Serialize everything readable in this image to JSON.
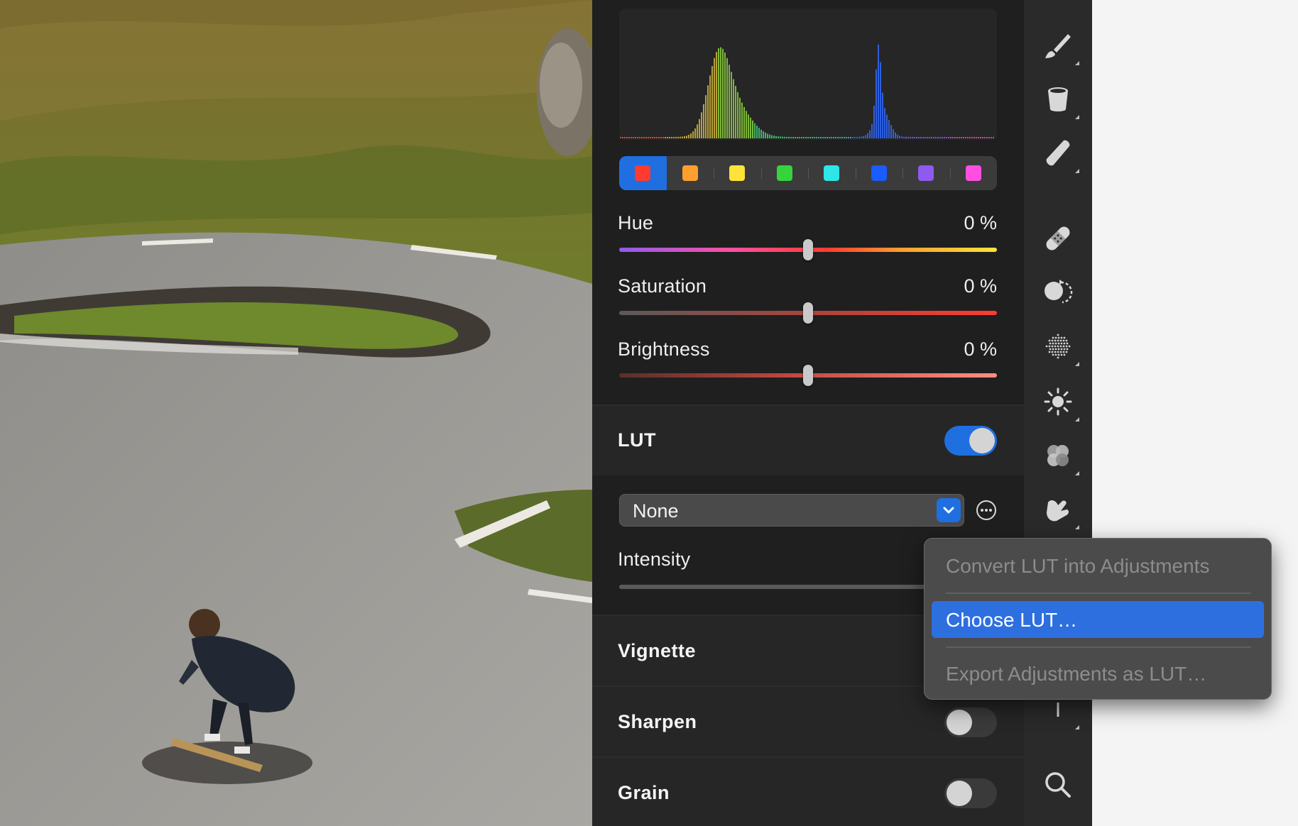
{
  "color_adjust": {
    "swatches": [
      "#ff3b30",
      "#ff9f2e",
      "#ffe23a",
      "#35d43c",
      "#2ee6e6",
      "#1a5cff",
      "#8e5bf0",
      "#ff4fe0"
    ],
    "active_swatch": 0,
    "hue": {
      "label": "Hue",
      "value": "0 %",
      "position": 0.5
    },
    "saturation": {
      "label": "Saturation",
      "value": "0 %",
      "position": 0.5
    },
    "brightness": {
      "label": "Brightness",
      "value": "0 %",
      "position": 0.5
    }
  },
  "lut": {
    "title": "LUT",
    "enabled": true,
    "selected": "None",
    "intensity_label": "Intensity"
  },
  "sections": {
    "vignette": "Vignette",
    "sharpen": {
      "label": "Sharpen",
      "enabled": false
    },
    "grain": {
      "label": "Grain",
      "enabled": false
    }
  },
  "context_menu": {
    "items": [
      {
        "label": "Convert LUT into Adjustments",
        "state": "disabled"
      },
      {
        "label": "Choose LUT…",
        "state": "highlighted"
      },
      {
        "label": "Export Adjustments as LUT…",
        "state": "disabled"
      }
    ]
  },
  "toolbar": {
    "tools": [
      "brush-icon",
      "paint-bucket-icon",
      "eraser-icon",
      "bandage-icon",
      "clone-icon",
      "noise-icon",
      "brightness-icon",
      "color-blend-icon",
      "smudge-icon",
      "line-icon",
      "zoom-icon"
    ]
  },
  "colors": {
    "accent": "#1f6fe0",
    "panel": "#1f1f1f",
    "toolbar": "#2a2a2a",
    "menu_highlight": "#2e6fdf"
  }
}
